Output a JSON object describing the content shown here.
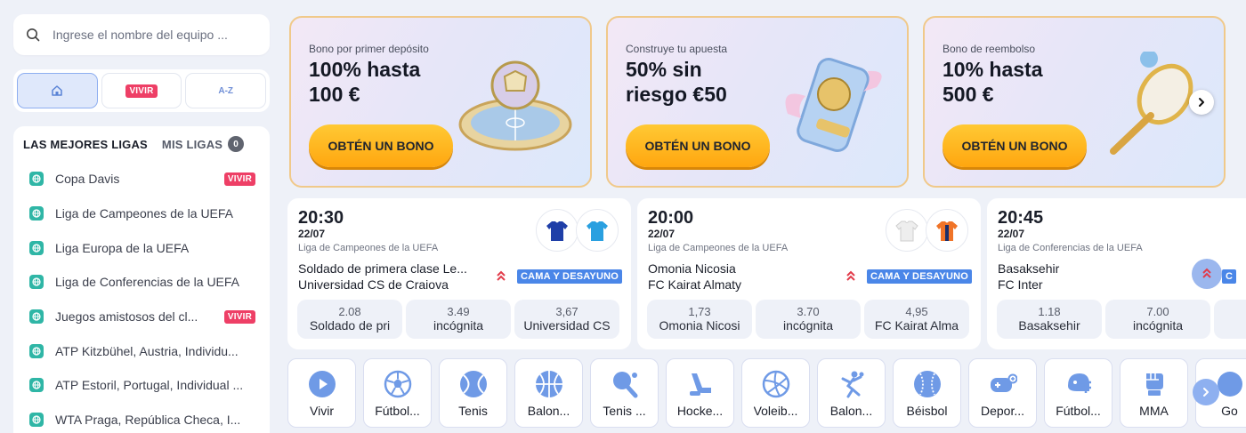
{
  "search": {
    "placeholder": "Ingrese el nombre del equipo ..."
  },
  "modes": {
    "live_label": "VIVIR",
    "az_label": "A-Z"
  },
  "leagues": {
    "tab_top": "LAS MEJORES LIGAS",
    "tab_mine": "MIS LIGAS",
    "mine_count": "0",
    "live_label": "VIVIR",
    "items": [
      {
        "name": "Copa Davis",
        "live": true
      },
      {
        "name": "Liga de Campeones de la UEFA",
        "live": false
      },
      {
        "name": "Liga Europa de la UEFA",
        "live": false
      },
      {
        "name": "Liga de Conferencias de la UEFA",
        "live": false
      },
      {
        "name": "Juegos amistosos del cl...",
        "live": true
      },
      {
        "name": "ATP Kitzbühel, Austria, Individu...",
        "live": false
      },
      {
        "name": "ATP Estoril, Portugal, Individual ...",
        "live": false
      },
      {
        "name": "WTA Praga, República Checa, I...",
        "live": false
      }
    ]
  },
  "banners": [
    {
      "subtitle": "Bono por primer depósito",
      "headline": "100% hasta 100 €",
      "cta": "OBTÉN UN BONO"
    },
    {
      "subtitle": "Construye tu apuesta",
      "headline": "50% sin riesgo €50",
      "cta": "OBTÉN UN BONO"
    },
    {
      "subtitle": "Bono de reembolso",
      "headline": "10% hasta 500 €",
      "cta": "OBTÉN UN BONO"
    }
  ],
  "matches": [
    {
      "time": "20:30",
      "date": "22/07",
      "competition": "Liga de Campeones de la UEFA",
      "team1": "Soldado de primera clase Le...",
      "team2": "Universidad CS de Craiova",
      "badge": "CAMA Y DESAYUNO",
      "odds": [
        {
          "value": "2.08",
          "name": "Soldado de pri"
        },
        {
          "value": "3.49",
          "name": "incógnita"
        },
        {
          "value": "3,67",
          "name": "Universidad CS"
        }
      ],
      "colors": {
        "home": "#1f3fa8",
        "away": "#2aa0e0"
      }
    },
    {
      "time": "20:00",
      "date": "22/07",
      "competition": "Liga de Campeones de la UEFA",
      "team1": "Omonia Nicosia",
      "team2": "FC Kairat Almaty",
      "badge": "CAMA Y DESAYUNO",
      "odds": [
        {
          "value": "1,73",
          "name": "Omonia Nicosi"
        },
        {
          "value": "3.70",
          "name": "incógnita"
        },
        {
          "value": "4,95",
          "name": "FC Kairat Alma"
        }
      ],
      "colors": {
        "home": "#f2f2f2",
        "away": "#f07428"
      }
    },
    {
      "time": "20:45",
      "date": "22/07",
      "competition": "Liga de Conferencias de la UEFA",
      "team1": "Basaksehir",
      "team2": "FC Inter",
      "badge": "C",
      "odds": [
        {
          "value": "1.18",
          "name": "Basaksehir"
        },
        {
          "value": "7.00",
          "name": "incógnita"
        }
      ],
      "colors": {
        "home": "#f07428",
        "away": "#1a2f6b"
      }
    }
  ],
  "sports": [
    {
      "label": "Vivir",
      "icon": "play-icon"
    },
    {
      "label": "Fútbol...",
      "icon": "soccer-ball-icon"
    },
    {
      "label": "Tenis",
      "icon": "tennis-ball-icon"
    },
    {
      "label": "Balon...",
      "icon": "basketball-icon"
    },
    {
      "label": "Tenis ...",
      "icon": "table-tennis-icon"
    },
    {
      "label": "Hocke...",
      "icon": "hockey-icon"
    },
    {
      "label": "Voleib...",
      "icon": "volleyball-icon"
    },
    {
      "label": "Balon...",
      "icon": "handball-icon"
    },
    {
      "label": "Béisbol",
      "icon": "baseball-icon"
    },
    {
      "label": "Depor...",
      "icon": "esports-gamepad-icon"
    },
    {
      "label": "Fútbol...",
      "icon": "american-football-helmet-icon"
    },
    {
      "label": "MMA",
      "icon": "mma-glove-icon"
    },
    {
      "label": "Go",
      "icon": "sport-icon"
    }
  ],
  "theme": {
    "accent": "#4a86e8",
    "live": "#ee3f66",
    "cta": "#ffb31c",
    "icon_blue": "#6f9ae6"
  }
}
